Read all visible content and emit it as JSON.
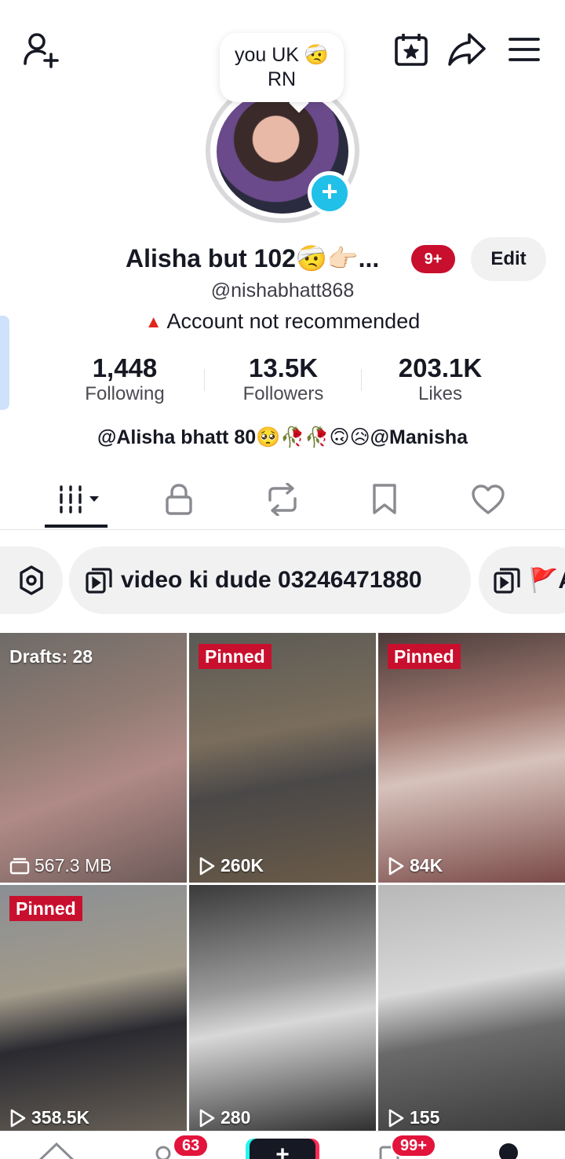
{
  "bubble_note": "you UK 🤕 RN",
  "profile": {
    "display_name": "Alisha but 102🤕👉🏻...",
    "notification_badge": "9+",
    "edit_label": "Edit",
    "username": "@nishabhatt868",
    "warning_text": "Account not recommended",
    "bio": "@Alisha bhatt 80🥺🥀🥀🙃😥@Manisha"
  },
  "stats": [
    {
      "value": "1,448",
      "label": "Following"
    },
    {
      "value": "13.5K",
      "label": "Followers"
    },
    {
      "value": "203.1K",
      "label": "Likes"
    }
  ],
  "tabs": [
    "videos-icon",
    "lock-icon",
    "repost-icon",
    "bookmark-icon",
    "heart-icon"
  ],
  "chips": {
    "playlist_label": "video ki dude 03246471880",
    "next_label": "🚩A"
  },
  "grid": [
    {
      "tag": "Drafts: 28",
      "count": "567.3 MB",
      "count_icon": "draft-box-icon"
    },
    {
      "tag": "Pinned",
      "count": "260K",
      "count_icon": "play-icon"
    },
    {
      "tag": "Pinned",
      "count": "84K",
      "count_icon": "play-icon"
    },
    {
      "tag": "Pinned",
      "count": "358.5K",
      "count_icon": "play-icon"
    },
    {
      "tag": "",
      "count": "280",
      "count_icon": "play-icon"
    },
    {
      "tag": "",
      "count": "155",
      "count_icon": "play-icon"
    }
  ],
  "bottom_nav": {
    "friends_badge": "63",
    "inbox_badge": "99+"
  },
  "colors": {
    "accent_red": "#c8102e",
    "plus_blue": "#20c0e8",
    "text": "#161823"
  }
}
